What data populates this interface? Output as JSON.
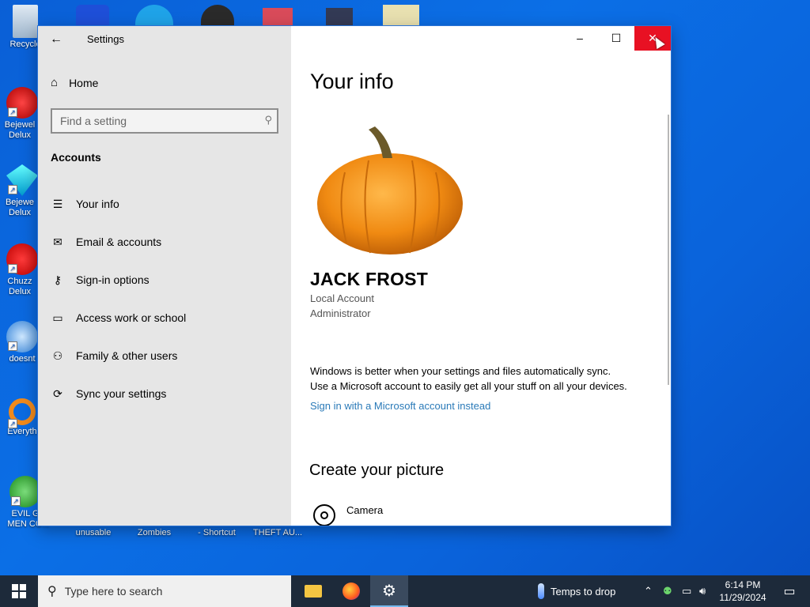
{
  "desktop": {
    "icons": [
      {
        "label": "Recycle"
      },
      {
        "label": "Bejewel Delux"
      },
      {
        "label": "Bejewe Delux"
      },
      {
        "label": "Chuzz Delux"
      },
      {
        "label": "doesnt"
      },
      {
        "label": "Everyth"
      },
      {
        "label": "EVIL GR MEN CO..."
      }
    ],
    "bottom_labels": [
      "unusable",
      "Zombies",
      "- Shortcut",
      "THEFT AU..."
    ]
  },
  "window": {
    "title": "Settings",
    "back_icon": "back-arrow-icon",
    "min_glyph": "–",
    "max_glyph": "☐",
    "close_glyph": "✕"
  },
  "sidebar": {
    "home_label": "Home",
    "search_placeholder": "Find a setting",
    "section_title": "Accounts",
    "items": [
      {
        "label": "Your info",
        "icon": "person-card-icon"
      },
      {
        "label": "Email & accounts",
        "icon": "mail-icon"
      },
      {
        "label": "Sign-in options",
        "icon": "key-icon"
      },
      {
        "label": "Access work or school",
        "icon": "briefcase-icon"
      },
      {
        "label": "Family & other users",
        "icon": "person-add-icon"
      },
      {
        "label": "Sync your settings",
        "icon": "sync-icon"
      }
    ]
  },
  "main": {
    "title": "Your info",
    "user_name": "JACK FROST",
    "account_type": "Local Account",
    "role": "Administrator",
    "sync_text_1": "Windows is better when your settings and files automatically sync.",
    "sync_text_2": "Use a Microsoft account to easily get all your stuff on all your devices.",
    "ms_link": "Sign in with a Microsoft account instead",
    "create_picture": "Create your picture",
    "camera_label": "Camera"
  },
  "taskbar": {
    "search_placeholder": "Type here to search",
    "weather": "Temps to drop",
    "time": "6:14 PM",
    "date": "11/29/2024"
  },
  "colors": {
    "accent_close": "#e81123",
    "link": "#2a7ab8",
    "desktop": "#0b6fe6",
    "taskbar": "#1d2a3a"
  }
}
